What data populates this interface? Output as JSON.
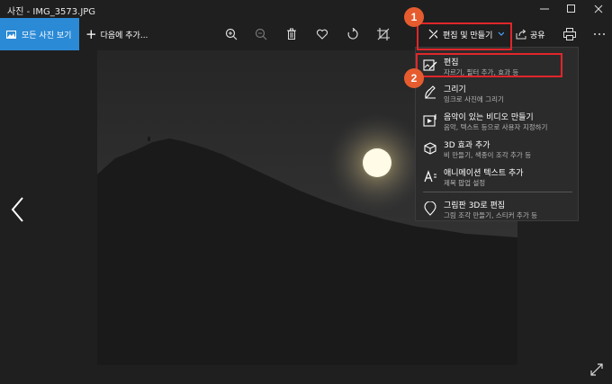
{
  "titlebar": {
    "title": "사진 - IMG_3573.JPG"
  },
  "toolbar": {
    "all_photos_label": "모든 사진 보기",
    "add_to_label": "다음에 추가...",
    "edit_create_label": "편집 및 만들기",
    "share_label": "공유"
  },
  "annotations": {
    "badge1": "1",
    "badge2": "2",
    "highlight_color": "#e0262b",
    "badge_color": "#e65c2e"
  },
  "menu": {
    "items": [
      {
        "title": "편집",
        "subtitle": "자르기, 필터 추가, 효과 등",
        "icon": "edit-photo-icon"
      },
      {
        "title": "그리기",
        "subtitle": "잉크로 사진에 그리기",
        "icon": "pen-icon"
      },
      {
        "title": "음악이 있는 비디오 만들기",
        "subtitle": "음악, 텍스트 등으로 사용자 지정하기",
        "icon": "video-music-icon"
      },
      {
        "title": "3D 효과 추가",
        "subtitle": "비 만들기, 색종이 조각 추가 등",
        "icon": "3d-effects-icon"
      },
      {
        "title": "애니메이션 텍스트 추가",
        "subtitle": "제목 팝업 설정",
        "icon": "animated-text-icon"
      },
      {
        "title": "그림판 3D로 편집",
        "subtitle": "그림 조각 만들기, 스티커 추가 등",
        "icon": "paint3d-icon"
      }
    ]
  },
  "colors": {
    "accent": "#2b8ad6",
    "background": "#1f1f1f",
    "menu_bg": "#2b2b2b"
  }
}
